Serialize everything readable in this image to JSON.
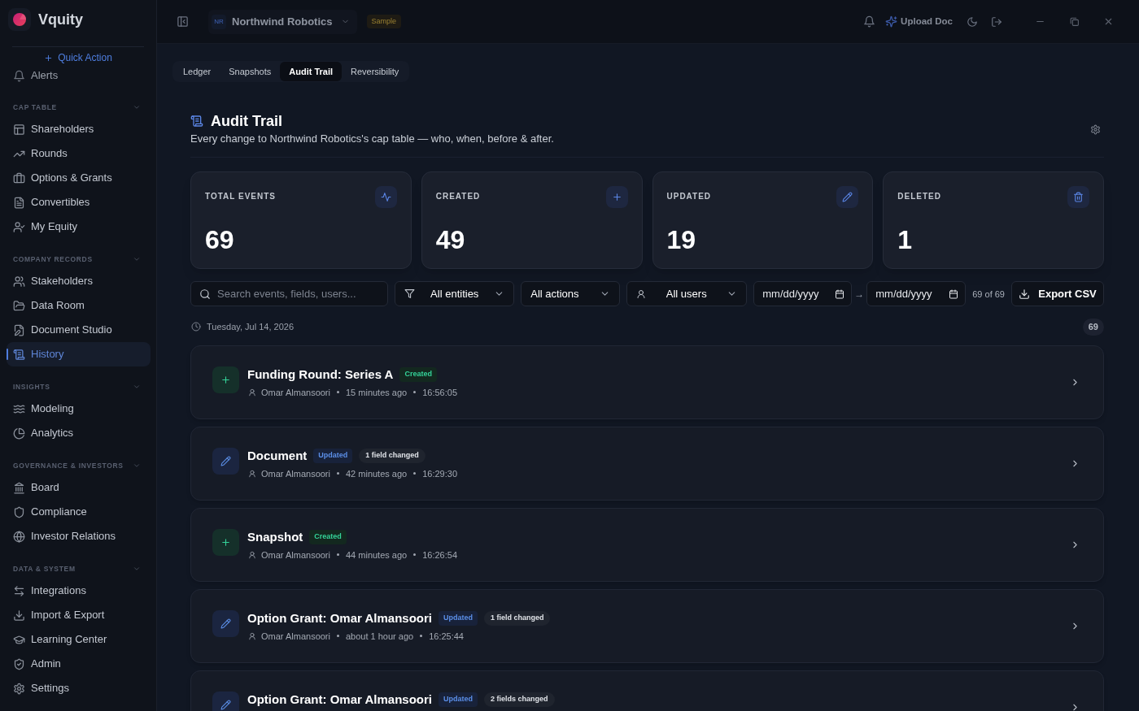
{
  "app": {
    "name": "Vquity",
    "quick_action": "Quick Action"
  },
  "sidebar": {
    "clipped_item": {
      "label": "Alerts"
    },
    "sections": [
      {
        "title": "CAP TABLE",
        "expanded": true,
        "items": [
          {
            "label": "Shareholders",
            "selected": false
          },
          {
            "label": "Rounds",
            "selected": false
          },
          {
            "label": "Options & Grants",
            "selected": false
          },
          {
            "label": "Convertibles",
            "selected": false
          },
          {
            "label": "My Equity",
            "selected": false
          }
        ]
      },
      {
        "title": "COMPANY RECORDS",
        "expanded": true,
        "items": [
          {
            "label": "Stakeholders",
            "selected": false
          },
          {
            "label": "Data Room",
            "selected": false
          },
          {
            "label": "Document Studio",
            "selected": false
          },
          {
            "label": "History",
            "selected": true
          }
        ]
      },
      {
        "title": "INSIGHTS",
        "expanded": true,
        "items": [
          {
            "label": "Modeling",
            "selected": false
          },
          {
            "label": "Analytics",
            "selected": false
          }
        ]
      },
      {
        "title": "GOVERNANCE & INVESTORS",
        "expanded": true,
        "items": [
          {
            "label": "Board",
            "selected": false
          },
          {
            "label": "Compliance",
            "selected": false
          },
          {
            "label": "Investor Relations",
            "selected": false
          }
        ]
      },
      {
        "title": "DATA & SYSTEM",
        "expanded": true,
        "items": [
          {
            "label": "Integrations",
            "selected": false
          },
          {
            "label": "Import & Export",
            "selected": false
          },
          {
            "label": "Learning Center",
            "selected": false
          },
          {
            "label": "Admin",
            "selected": false
          },
          {
            "label": "Settings",
            "selected": false
          }
        ]
      }
    ]
  },
  "top_bar": {
    "company": {
      "initials": "NR",
      "name": "Northwind Robotics",
      "badge": "Sample"
    },
    "upload_button": "Upload Doc"
  },
  "tabs": [
    {
      "label": "Ledger",
      "selected": false
    },
    {
      "label": "Snapshots",
      "selected": false
    },
    {
      "label": "Audit Trail",
      "selected": true
    },
    {
      "label": "Reversibility",
      "selected": false
    }
  ],
  "page": {
    "title": "Audit Trail",
    "subtitle": "Every change to Northwind Robotics's cap table — who, when, before & after."
  },
  "stats": [
    {
      "kind": "total",
      "label": "TOTAL EVENTS",
      "value": "69"
    },
    {
      "kind": "created",
      "label": "CREATED",
      "value": "49"
    },
    {
      "kind": "updated",
      "label": "UPDATED",
      "value": "19"
    },
    {
      "kind": "deleted",
      "label": "DELETED",
      "value": "1"
    }
  ],
  "filters": {
    "search": {
      "placeholder": "Search events, fields, users..."
    },
    "entity": "All entities",
    "action": "All actions",
    "user": "All users",
    "date_from": {
      "placeholder": "mm/dd/yyyy"
    },
    "range_separator": "→",
    "date_to": {
      "placeholder": "mm/dd/yyyy"
    },
    "count": "69 of 69",
    "export_button": "Export CSV"
  },
  "group": {
    "date": "Tuesday, Jul 14, 2026",
    "count": "69"
  },
  "events": [
    {
      "kind": "created",
      "title": "Funding Round: Series A",
      "action": "Created",
      "user": "Omar Almansoori",
      "relative_time": "15 minutes ago",
      "time": "16:56:05"
    },
    {
      "kind": "updated",
      "title": "Document",
      "action": "Updated",
      "changes": "1 field changed",
      "user": "Omar Almansoori",
      "relative_time": "42 minutes ago",
      "time": "16:29:30"
    },
    {
      "kind": "created",
      "title": "Snapshot",
      "action": "Created",
      "user": "Omar Almansoori",
      "relative_time": "44 minutes ago",
      "time": "16:26:54"
    },
    {
      "kind": "updated",
      "title": "Option Grant: Omar Almansoori",
      "action": "Updated",
      "changes": "1 field changed",
      "user": "Omar Almansoori",
      "relative_time": "about 1 hour ago",
      "time": "16:25:44"
    },
    {
      "kind": "updated",
      "title": "Option Grant: Omar Almansoori",
      "action": "Updated",
      "changes": "2 fields changed"
    }
  ]
}
